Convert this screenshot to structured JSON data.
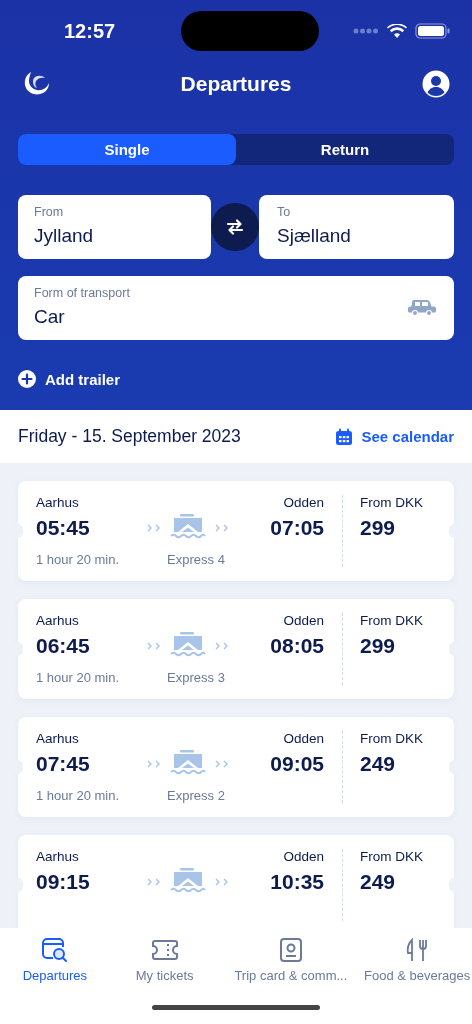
{
  "status_bar": {
    "time": "12:57"
  },
  "header": {
    "title": "Departures"
  },
  "trip_type_tabs": [
    {
      "label": "Single",
      "selected": true
    },
    {
      "label": "Return",
      "selected": false
    }
  ],
  "from_field": {
    "label": "From",
    "value": "Jylland"
  },
  "to_field": {
    "label": "To",
    "value": "Sjælland"
  },
  "transport_field": {
    "label": "Form of transport",
    "value": "Car"
  },
  "add_trailer": {
    "label": "Add trailer"
  },
  "date_bar": {
    "date": "Friday - 15. September 2023",
    "calendar_link": "See calendar"
  },
  "departures": [
    {
      "origin": "Aarhus",
      "depart": "05:45",
      "destination": "Odden",
      "arrive": "07:05",
      "price_label": "From DKK",
      "price": "299",
      "duration": "1 hour 20 min.",
      "vessel": "Express 4"
    },
    {
      "origin": "Aarhus",
      "depart": "06:45",
      "destination": "Odden",
      "arrive": "08:05",
      "price_label": "From DKK",
      "price": "299",
      "duration": "1 hour 20 min.",
      "vessel": "Express 3"
    },
    {
      "origin": "Aarhus",
      "depart": "07:45",
      "destination": "Odden",
      "arrive": "09:05",
      "price_label": "From DKK",
      "price": "249",
      "duration": "1 hour 20 min.",
      "vessel": "Express 2"
    },
    {
      "origin": "Aarhus",
      "depart": "09:15",
      "destination": "Odden",
      "arrive": "10:35",
      "price_label": "From DKK",
      "price": "249"
    }
  ],
  "tab_bar": [
    {
      "kind": "departures",
      "label": "Departures",
      "selected": true
    },
    {
      "kind": "tickets",
      "label": "My tickets",
      "selected": false
    },
    {
      "kind": "card",
      "label": "Trip card & comm...",
      "selected": false
    },
    {
      "kind": "food",
      "label": "Food & beverages",
      "selected": false
    }
  ]
}
